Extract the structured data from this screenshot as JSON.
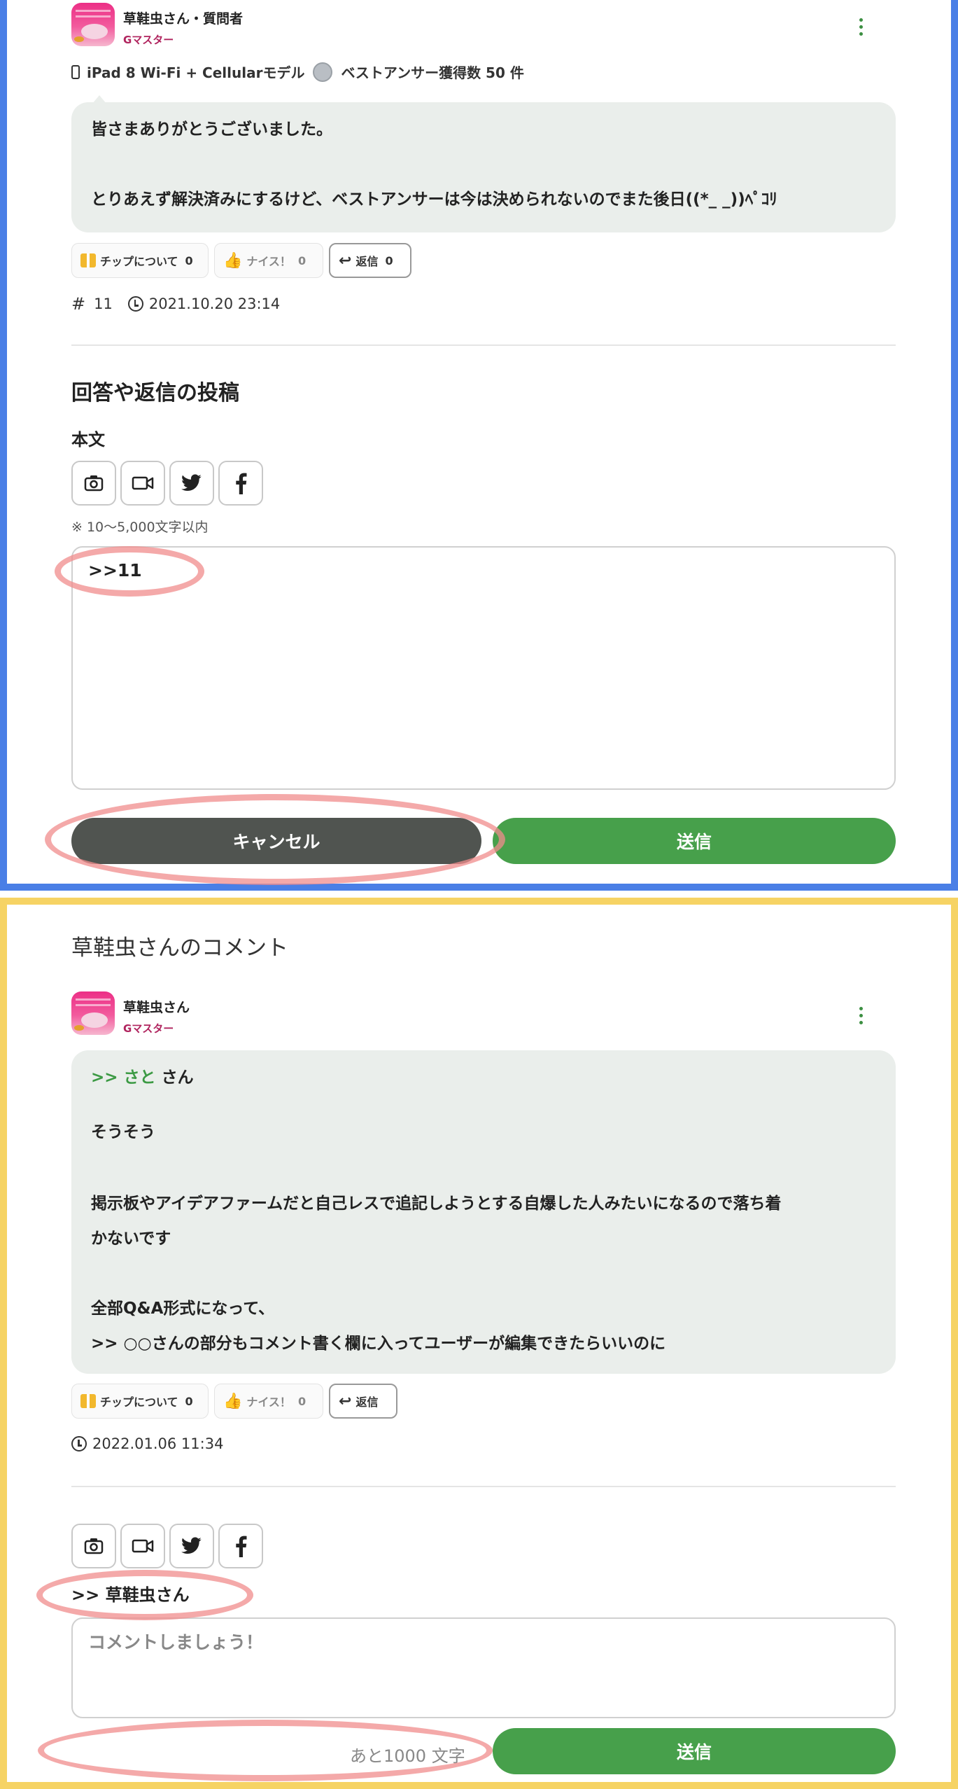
{
  "top": {
    "user_name": "草鞋虫さん・質問者",
    "rank": "Gマスター",
    "device_line": "iPad 8 Wi-Fi + Cellularモデル",
    "best_answer_text": "ベストアンサー獲得数 50 件",
    "message_line1": "皆さまありがとうございました。",
    "message_line2": "とりあえず解決済みにするけど、ベストアンサーは今は決められないのでまた後日((*_ _))ﾍﾟｺﾘ",
    "tip_label": "チップについて",
    "tip_count": "0",
    "nice_label": "ナイス！",
    "nice_count": "0",
    "reply_label": "返信",
    "reply_count": "0",
    "post_number": "11",
    "timestamp": "2021.10.20 23:14",
    "form_heading": "回答や返信の投稿",
    "body_label": "本文",
    "char_note": "※ 10〜5,000文字以内",
    "textarea_value": ">>11",
    "cancel_label": "キャンセル",
    "send_label": "送信"
  },
  "bottom": {
    "section_title": "草鞋虫さんのコメント",
    "user_name": "草鞋虫さん",
    "rank": "Gマスター",
    "reply_prefix": ">> さと",
    "reply_suffix": " さん",
    "line1": "そうそう",
    "line2": "掲示板やアイデアファームだと自己レスで追記しようとする自爆した人みたいになるので落ち着",
    "line3": "かないです",
    "line4": "全部Q&A形式になって、",
    "line5": ">> ○○さんの部分もコメント書く欄に入ってユーザーが編集できたらいいのに",
    "tip_label": "チップについて",
    "tip_count": "0",
    "nice_label": "ナイス！",
    "nice_count": "0",
    "reply_label": "返信",
    "timestamp": "2022.01.06 11:34",
    "reply_target": ">> 草鞋虫さん",
    "comment_placeholder": "コメントしましょう！",
    "remaining": "あと1000 文字",
    "send_label": "送信"
  },
  "colors": {
    "frame_top": "#4a7fe6",
    "frame_bottom": "#f6d364",
    "send": "#47a04b",
    "cancel": "#505450",
    "highlight": "#f08c8c"
  }
}
